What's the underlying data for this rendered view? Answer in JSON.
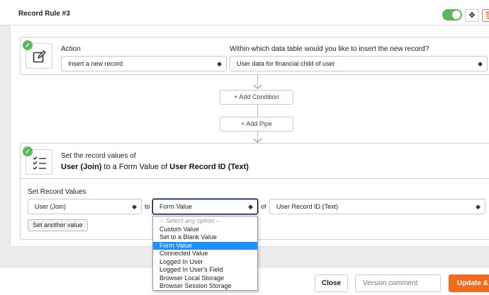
{
  "header": {
    "title": "Record Rule #3",
    "toggle_on": true,
    "delete_label": "!"
  },
  "action_card": {
    "action_label": "Action",
    "action_value": "Insert a new record",
    "table_label": "Within which data table would you like to insert the new record?",
    "table_value": "User data for financial child of user"
  },
  "pipeline": {
    "add_condition": "+ Add Condition",
    "add_pipe": "+ Add Pipe"
  },
  "set_card": {
    "line1": "Set the record values of",
    "target_field": "User (Join)",
    "mid_text": " to a Form Value of ",
    "source_field": "User Record ID (Text)"
  },
  "set_values": {
    "label": "Set Record Values",
    "field_value": "User (Join)",
    "to_text": "to",
    "type_value": "Form Value",
    "of_text": "of",
    "source_value": "User Record ID (Text)",
    "set_another": "Set another value"
  },
  "dropdown": {
    "options": [
      "-- Select any option --",
      "Custom Value",
      "Set to a Blank Value",
      "Form Value",
      "Connected Value",
      "Logged In User",
      "Logged In User's Field",
      "Browser Local Storage",
      "Browser Session Storage"
    ],
    "selected": "Form Value"
  },
  "footer": {
    "close": "Close",
    "comment_placeholder": "Version comment",
    "update": "Update & Save"
  },
  "colors": {
    "accent": "#f26b1d",
    "success": "#5cb85c",
    "selected": "#1e90ff"
  }
}
